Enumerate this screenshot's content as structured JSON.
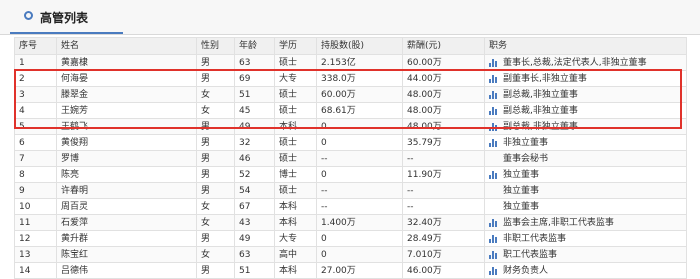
{
  "header": {
    "title": "高管列表"
  },
  "table": {
    "columns": [
      "序号",
      "姓名",
      "性别",
      "年龄",
      "学历",
      "持股数(股)",
      "薪酬(元)",
      "职务"
    ],
    "rows": [
      {
        "no": "1",
        "name": "黄嘉棣",
        "gender": "男",
        "age": "63",
        "edu": "硕士",
        "shares": "2.153亿",
        "pay": "60.00万",
        "duty": "董事长,总裁,法定代表人,非独立董事",
        "chart": true
      },
      {
        "no": "2",
        "name": "何海晏",
        "gender": "男",
        "age": "69",
        "edu": "大专",
        "shares": "338.0万",
        "pay": "44.00万",
        "duty": "副董事长,非独立董事",
        "chart": true
      },
      {
        "no": "3",
        "name": "滕翠金",
        "gender": "女",
        "age": "51",
        "edu": "硕士",
        "shares": "60.00万",
        "pay": "48.00万",
        "duty": "副总裁,非独立董事",
        "chart": true
      },
      {
        "no": "4",
        "name": "王婉芳",
        "gender": "女",
        "age": "45",
        "edu": "硕士",
        "shares": "68.61万",
        "pay": "48.00万",
        "duty": "副总裁,非独立董事",
        "chart": true
      },
      {
        "no": "5",
        "name": "王鹤飞",
        "gender": "男",
        "age": "49",
        "edu": "本科",
        "shares": "0",
        "pay": "48.00万",
        "duty": "副总裁,非独立董事",
        "chart": true
      },
      {
        "no": "6",
        "name": "黄俊翔",
        "gender": "男",
        "age": "32",
        "edu": "硕士",
        "shares": "0",
        "pay": "35.79万",
        "duty": "非独立董事",
        "chart": true
      },
      {
        "no": "7",
        "name": "罗博",
        "gender": "男",
        "age": "46",
        "edu": "硕士",
        "shares": "--",
        "pay": "--",
        "duty": "董事会秘书",
        "chart": false
      },
      {
        "no": "8",
        "name": "陈亮",
        "gender": "男",
        "age": "52",
        "edu": "博士",
        "shares": "0",
        "pay": "11.90万",
        "duty": "独立董事",
        "chart": true
      },
      {
        "no": "9",
        "name": "许春明",
        "gender": "男",
        "age": "54",
        "edu": "硕士",
        "shares": "--",
        "pay": "--",
        "duty": "独立董事",
        "chart": false
      },
      {
        "no": "10",
        "name": "周百灵",
        "gender": "女",
        "age": "67",
        "edu": "本科",
        "shares": "--",
        "pay": "--",
        "duty": "独立董事",
        "chart": false
      },
      {
        "no": "11",
        "name": "石爱萍",
        "gender": "女",
        "age": "43",
        "edu": "本科",
        "shares": "1.400万",
        "pay": "32.40万",
        "duty": "监事会主席,非职工代表监事",
        "chart": true
      },
      {
        "no": "12",
        "name": "黄升群",
        "gender": "男",
        "age": "49",
        "edu": "大专",
        "shares": "0",
        "pay": "28.49万",
        "duty": "非职工代表监事",
        "chart": true
      },
      {
        "no": "13",
        "name": "陈宝红",
        "gender": "女",
        "age": "63",
        "edu": "高中",
        "shares": "0",
        "pay": "7.010万",
        "duty": "职工代表监事",
        "chart": true
      },
      {
        "no": "14",
        "name": "吕德伟",
        "gender": "男",
        "age": "51",
        "edu": "本科",
        "shares": "27.00万",
        "pay": "46.00万",
        "duty": "财务负责人",
        "chart": true
      }
    ]
  },
  "colors": {
    "accent": "#4a7bbf",
    "highlight": "#e0322b"
  },
  "icons": {
    "chart": "bar-chart-icon",
    "header": "circle-icon"
  }
}
